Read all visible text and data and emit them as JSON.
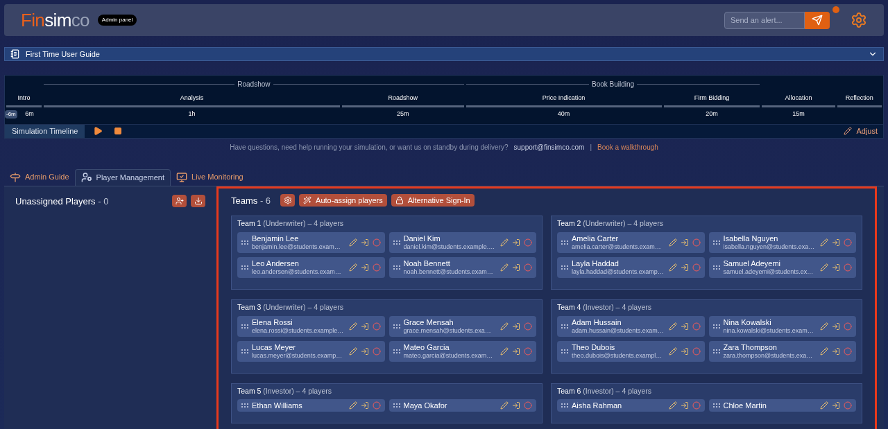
{
  "header": {
    "logo_parts": [
      "Fin",
      "sim",
      "co"
    ],
    "badge": "Admin panel",
    "alert_placeholder": "Send an alert..."
  },
  "guide": {
    "title": "First Time User Guide",
    "expanded": false
  },
  "timeline": {
    "offset": "-6m",
    "sections": [
      {
        "phases": [
          {
            "name": "Intro",
            "duration": "6m"
          }
        ]
      },
      {
        "label": "Roadshow",
        "phases": [
          {
            "name": "Analysis",
            "duration": "1h"
          },
          {
            "name": "Roadshow",
            "duration": "25m"
          }
        ]
      },
      {
        "label": "Book Building",
        "phases": [
          {
            "name": "Price Indication",
            "duration": "40m"
          },
          {
            "name": "Firm Bidding",
            "duration": "20m"
          }
        ]
      },
      {
        "phases": [
          {
            "name": "Allocation",
            "duration": "15m"
          }
        ]
      },
      {
        "phases": [
          {
            "name": "Reflection"
          }
        ]
      }
    ],
    "footer_label": "Simulation Timeline",
    "adjust": "Adjust"
  },
  "help": {
    "text": "Have questions, need help running your simulation, or want us on standby during delivery?",
    "email": "support@finsimco.com",
    "separator": "|",
    "link": "Book a walkthrough"
  },
  "tabs": [
    {
      "label": "Admin Guide",
      "selected": false,
      "kind": "signpost"
    },
    {
      "label": "Player Management",
      "selected": true,
      "kind": "user"
    },
    {
      "label": "Live Monitoring",
      "selected": false,
      "kind": "monitor"
    }
  ],
  "unassigned": {
    "title": "Unassigned Players",
    "count": "- 0"
  },
  "teams": {
    "title": "Teams",
    "count": "- 6",
    "buttons": [
      "Auto-assign players",
      "Alternative Sign-In"
    ],
    "list": [
      {
        "name": "Team 1",
        "role": "(Underwriter) – 4 players",
        "players": [
          {
            "name": "Benjamin Lee",
            "email": "benjamin.lee@students.exam…"
          },
          {
            "name": "Daniel Kim",
            "email": "daniel.kim@students.example.…"
          },
          {
            "name": "Leo Andersen",
            "email": "leo.andersen@students.exam…"
          },
          {
            "name": "Noah Bennett",
            "email": "noah.bennett@students.exam…"
          }
        ]
      },
      {
        "name": "Team 2",
        "role": "(Underwriter) – 4 players",
        "players": [
          {
            "name": "Amelia Carter",
            "email": "amelia.carter@students.exam…"
          },
          {
            "name": "Isabella Nguyen",
            "email": "isabella.nguyen@students.exa…"
          },
          {
            "name": "Layla Haddad",
            "email": "layla.haddad@students.examp…"
          },
          {
            "name": "Samuel Adeyemi",
            "email": "samuel.adeyemi@students.ex…"
          }
        ]
      },
      {
        "name": "Team 3",
        "role": "(Underwriter) – 4 players",
        "players": [
          {
            "name": "Elena Rossi",
            "email": "elena.rossi@students.example…"
          },
          {
            "name": "Grace Mensah",
            "email": "grace.mensah@students.exa…"
          },
          {
            "name": "Lucas Meyer",
            "email": "lucas.meyer@students.examp…"
          },
          {
            "name": "Mateo Garcia",
            "email": "mateo.garcia@students.exam…"
          }
        ]
      },
      {
        "name": "Team 4",
        "role": "(Investor) – 4 players",
        "players": [
          {
            "name": "Adam Hussain",
            "email": "adam.hussain@students.exam…"
          },
          {
            "name": "Nina Kowalski",
            "email": "nina.kowalski@students.exam…"
          },
          {
            "name": "Theo Dubois",
            "email": "theo.dubois@students.exampl…"
          },
          {
            "name": "Zara Thompson",
            "email": "zara.thompson@students.exa…"
          }
        ]
      },
      {
        "name": "Team 5",
        "role": "(Investor) – 4 players",
        "players": [
          {
            "name": "Ethan Williams"
          },
          {
            "name": "Maya Okafor"
          }
        ]
      },
      {
        "name": "Team 6",
        "role": "(Investor) – 4 players",
        "players": [
          {
            "name": "Aisha Rahman"
          },
          {
            "name": "Chloe Martin"
          }
        ]
      }
    ]
  }
}
